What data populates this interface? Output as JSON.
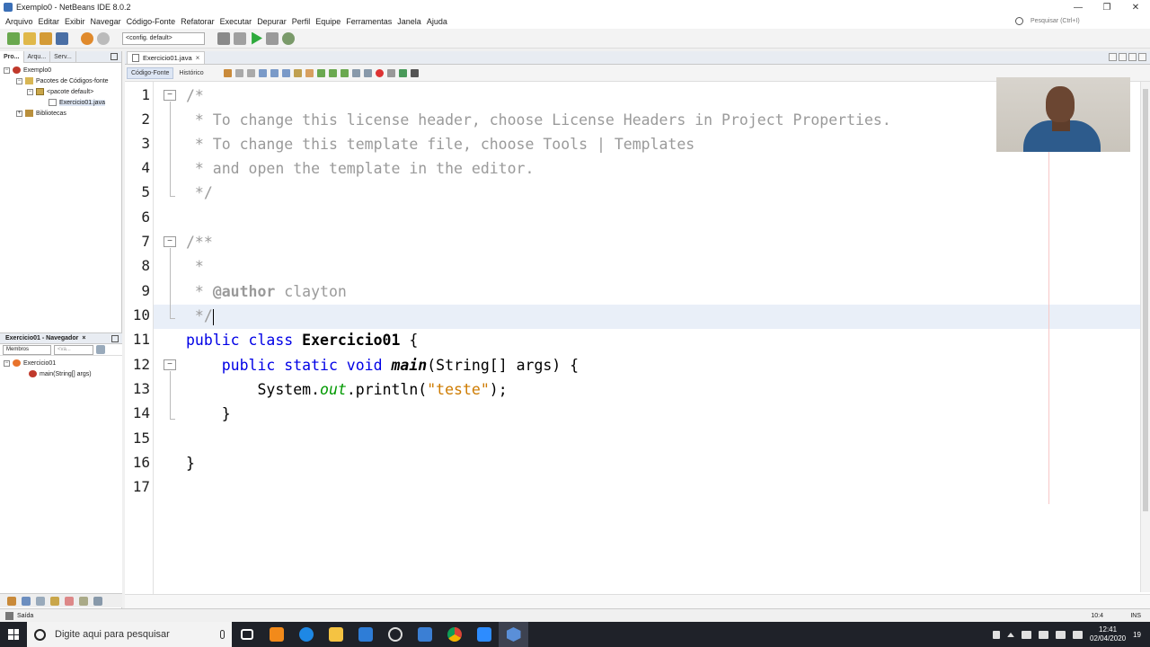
{
  "window": {
    "title": "Exemplo0 - NetBeans IDE 8.0.2"
  },
  "menu": {
    "items": [
      "Arquivo",
      "Editar",
      "Exibir",
      "Navegar",
      "Código-Fonte",
      "Refatorar",
      "Executar",
      "Depurar",
      "Perfil",
      "Equipe",
      "Ferramentas",
      "Janela",
      "Ajuda"
    ],
    "search_placeholder": "Pesquisar (Ctrl+I)"
  },
  "toolbar": {
    "config_label": "<config. default>"
  },
  "projects_panel": {
    "tabs": [
      "Pro...",
      "Arqu...",
      "Serv..."
    ],
    "tree": {
      "project": "Exemplo0",
      "source_packages": "Pacotes de Códigos-fonte",
      "default_package": "<pacote default>",
      "file": "Exercicio01.java",
      "libraries": "Bibliotecas"
    }
  },
  "navigator": {
    "title": "Exercicio01 - Navegador",
    "filter_members": "Membros",
    "filter_empty": "<va...",
    "class_name": "Exercicio01",
    "method": "main(String[] args)"
  },
  "editor": {
    "tab_label": "Exercicio01.java",
    "subtabs": [
      "Código-Fonte",
      "Histórico"
    ],
    "line_numbers": [
      "1",
      "2",
      "3",
      "4",
      "5",
      "6",
      "7",
      "8",
      "9",
      "10",
      "11",
      "12",
      "13",
      "14",
      "15",
      "16",
      "17"
    ],
    "code": {
      "l1": "/*",
      "l2": " * To change this license header, choose License Headers in Project Properties.",
      "l3": " * To change this template file, choose Tools | Templates",
      "l4": " * and open the template in the editor.",
      "l5": " */",
      "l7": "/**",
      "l8": " *",
      "l9_star": " * ",
      "l9_tag": "@author",
      "l9_name": " clayton",
      "l10": " */",
      "l11_kw": "public class ",
      "l11_cls": "Exercicio01",
      "l11_rest": " {",
      "l12_kw": "    public static void ",
      "l12_mth": "main",
      "l12_rest": "(String[] args) {",
      "l13_a": "        System.",
      "l13_fld": "out",
      "l13_b": ".println(",
      "l13_str": "\"teste\"",
      "l13_c": ");",
      "l14": "    }",
      "l16": "}"
    }
  },
  "statusbar": {
    "output": "Saída",
    "position": "10:4",
    "mode": "INS"
  },
  "taskbar": {
    "search_placeholder": "Digite aqui para pesquisar",
    "time": "12:41",
    "date": "02/04/2020",
    "notifications": "19"
  }
}
